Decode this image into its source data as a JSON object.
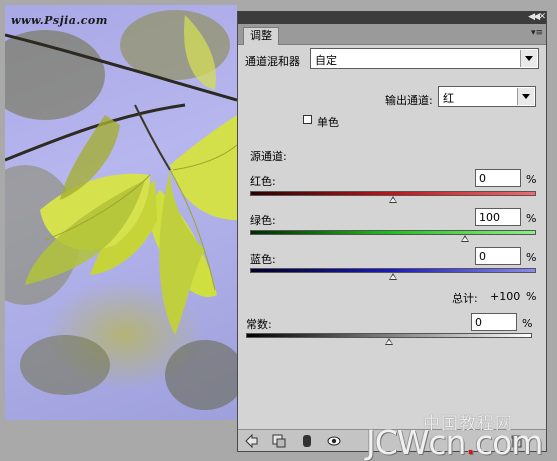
{
  "watermark_top": "www.Psjia.com",
  "panel": {
    "tab_label": "调整",
    "preset_label": "通道混和器",
    "preset_value": "自定",
    "output_channel_label": "输出通道:",
    "output_channel_value": "红",
    "monochrome_label": "单色",
    "monochrome_checked": false,
    "source_channels_label": "源通道:",
    "channels": [
      {
        "label": "红色:",
        "value": "0",
        "unit": "%",
        "level": 0,
        "colors": [
          "#2a0000",
          "#c2141b",
          "#ef6b71"
        ]
      },
      {
        "label": "绿色:",
        "value": "100",
        "unit": "%",
        "level": 100,
        "colors": [
          "#002a00",
          "#1fc41a",
          "#8ef08a"
        ]
      },
      {
        "label": "蓝色:",
        "value": "0",
        "unit": "%",
        "level": 0,
        "colors": [
          "#00002a",
          "#1a1ac4",
          "#8a8af0"
        ]
      }
    ],
    "total_label": "总计:",
    "total_value": "+100",
    "total_unit": "%",
    "constant_label": "常数:",
    "constant_value": "0",
    "constant_unit": "%",
    "constant_level": 0
  },
  "watermark_bottom": {
    "cn": "中国教程网",
    "en_pre": "JCWcn",
    "en_dot": ".",
    "en_post": "com"
  }
}
